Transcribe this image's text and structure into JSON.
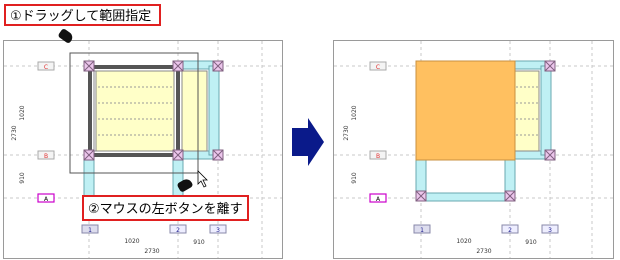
{
  "steps": {
    "step1": "①ドラッグして範囲指定",
    "step2": "②マウスの左ボタンを離す"
  },
  "grid_labels": {
    "row_c": "C",
    "row_b": "B",
    "row_a": "A",
    "col_1": "1",
    "col_2": "2",
    "col_3": "3"
  },
  "dimensions": {
    "span_ab": "910",
    "span_bc": "1020",
    "total_vertical": "2730",
    "span_12": "1020",
    "span_23": "910",
    "total_horizontal": "2730"
  },
  "colors": {
    "beam_fill": "#bff0f4",
    "floor_fill": "#ffffc8",
    "column_fill": "#ecc6ec",
    "selected_fill": "#ffc060",
    "callout_border": "#e02020",
    "arrow": "#0a1a8a",
    "row_label_red": "#e03030",
    "row_label_pink": "#cc00cc",
    "col_label": "#1a1a8a"
  },
  "icons": {
    "process_arrow": "arrow-right-icon",
    "hand_pointer": "hand-pointer-icon",
    "mouse_cursor": "mouse-cursor-icon"
  }
}
